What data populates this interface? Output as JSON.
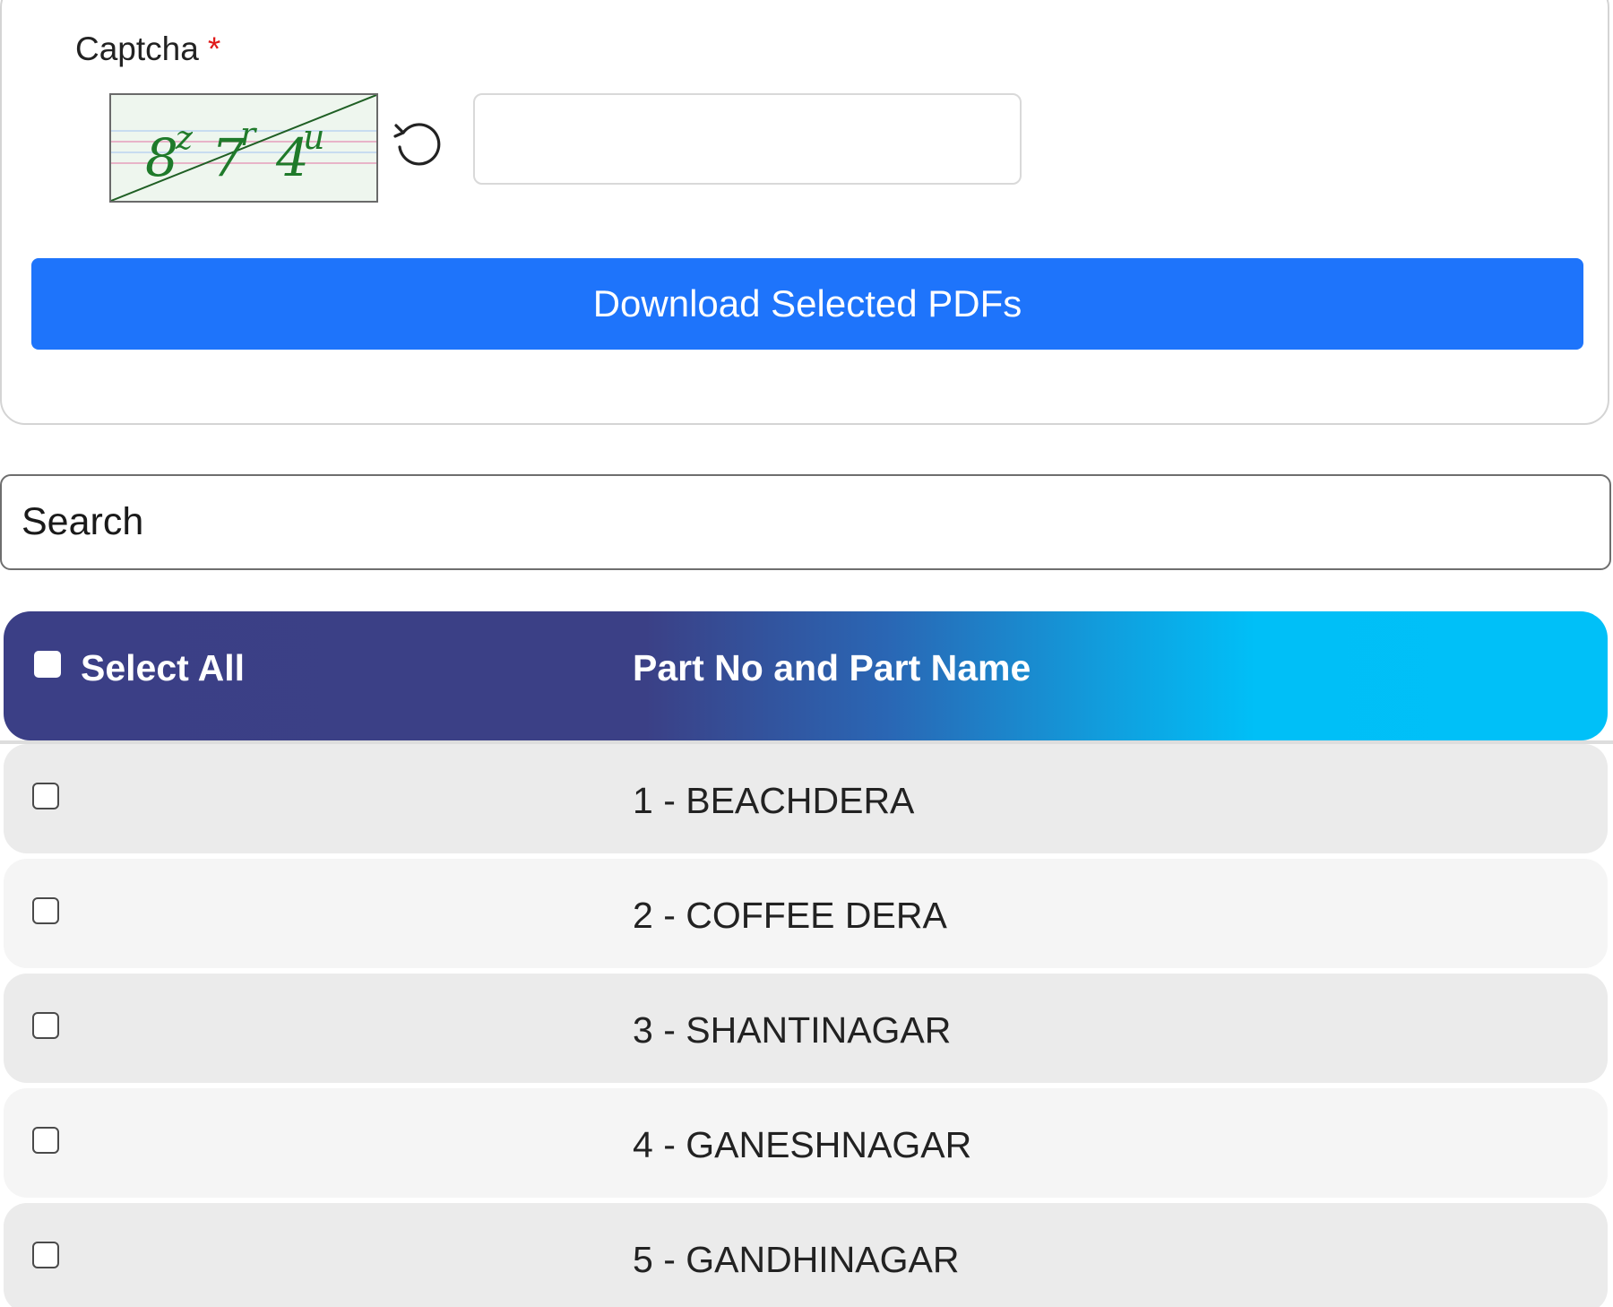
{
  "captcha": {
    "label": "Captcha",
    "required_marker": "*",
    "image_text": "8z7r4u",
    "input_value": ""
  },
  "download_button_label": "Download Selected PDFs",
  "search": {
    "placeholder": "Search",
    "value": ""
  },
  "table": {
    "header": {
      "select_all_label": "Select All",
      "part_column_label": "Part No and Part Name",
      "gradient_colors": [
        "#3b3f86",
        "#00c0f8"
      ]
    },
    "rows": [
      {
        "label": "1 - BEACHDERA",
        "checked": false
      },
      {
        "label": "2 - COFFEE DERA",
        "checked": false
      },
      {
        "label": "3 - SHANTINAGAR",
        "checked": false
      },
      {
        "label": "4 - GANESHNAGAR",
        "checked": false
      },
      {
        "label": "5 - GANDHINAGAR",
        "checked": false
      }
    ]
  },
  "colors": {
    "primary_button": "#1e74fb",
    "required_star": "#e01919",
    "row_odd": "#ebebeb",
    "row_even": "#f5f5f5"
  }
}
